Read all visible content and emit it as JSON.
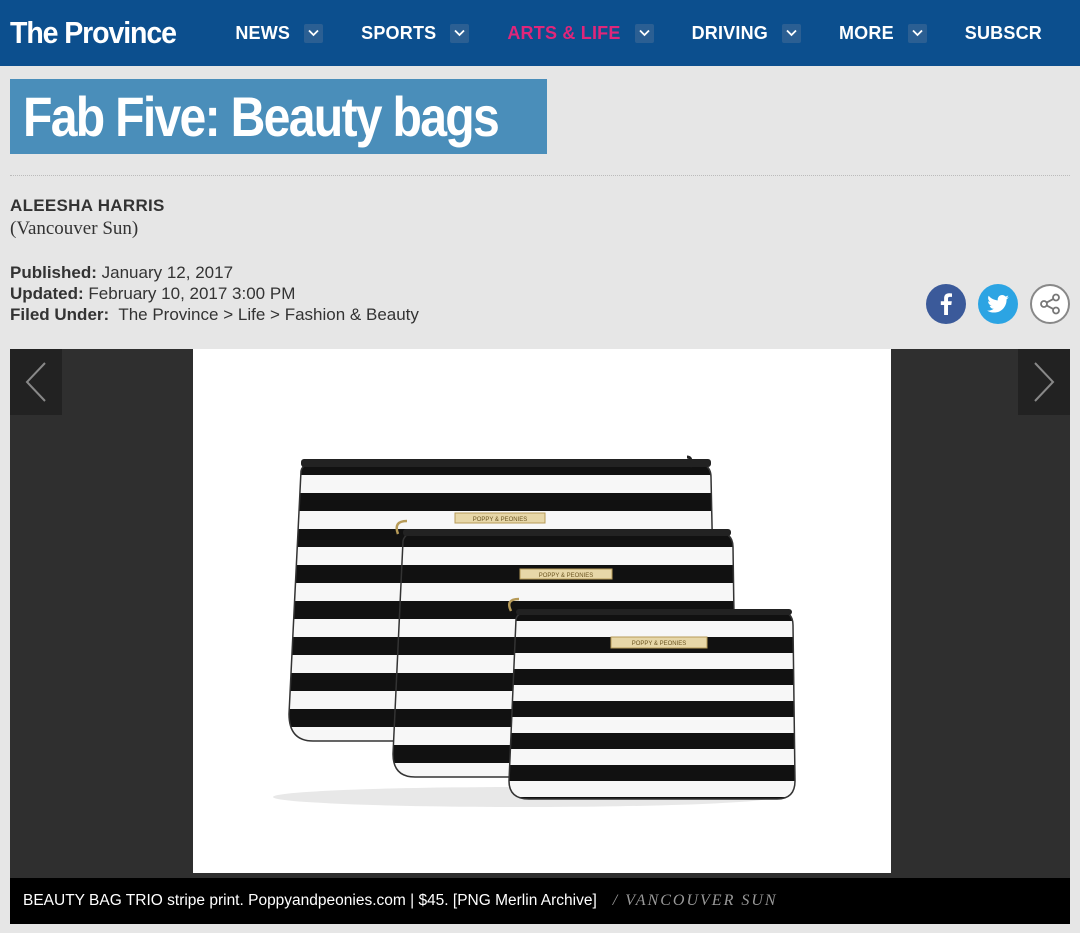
{
  "header": {
    "logo": "The Province",
    "nav": [
      {
        "label": "NEWS",
        "active": false
      },
      {
        "label": "SPORTS",
        "active": false
      },
      {
        "label": "ARTS & LIFE",
        "active": true
      },
      {
        "label": "DRIVING",
        "active": false
      },
      {
        "label": "MORE",
        "active": false
      },
      {
        "label": "SUBSCR",
        "active": false
      }
    ]
  },
  "article": {
    "title": "Fab Five: Beauty bags",
    "author": "ALEESHA HARRIS",
    "source": "(Vancouver Sun)",
    "published_label": "Published:",
    "published": "January 12, 2017",
    "updated_label": "Updated:",
    "updated": "February 10, 2017 3:00 PM",
    "filed_label": "Filed Under:",
    "breadcrumbs": [
      "The Province",
      "Life",
      "Fashion & Beauty"
    ],
    "breadcrumb_sep": ">"
  },
  "social": [
    "facebook-icon",
    "twitter-icon",
    "share-icon"
  ],
  "gallery": {
    "brand_label": "POPPY & PEONIES",
    "caption": "BEAUTY BAG TRIO stripe print. Poppyandpeonies.com | $45. [PNG Merlin Archive]",
    "credit": "/ VANCOUVER SUN"
  },
  "colors": {
    "header_bg": "#0c4f8e",
    "active_nav": "#e0267a",
    "title_bg": "#4a8eba",
    "facebook": "#3b5a9a",
    "twitter": "#2ca4e3"
  }
}
